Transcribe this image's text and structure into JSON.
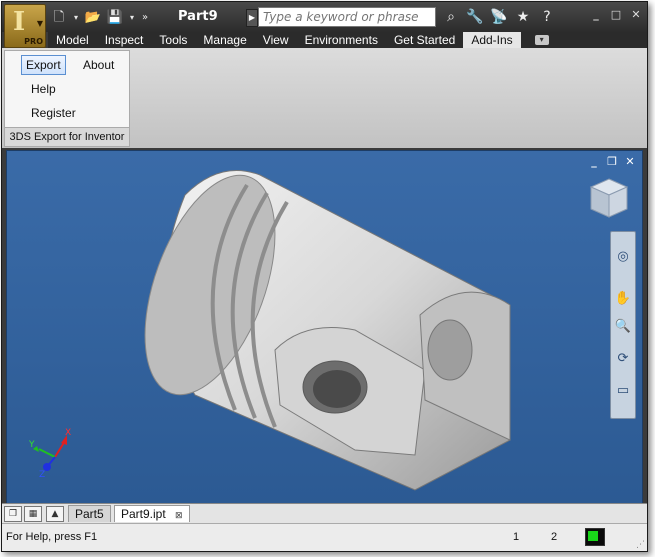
{
  "window": {
    "title": "Part9",
    "app_badge": "PRO",
    "search_placeholder": "Type a keyword or phrase"
  },
  "tabs": [
    {
      "label": "Model"
    },
    {
      "label": "Inspect"
    },
    {
      "label": "Tools"
    },
    {
      "label": "Manage"
    },
    {
      "label": "View"
    },
    {
      "label": "Environments"
    },
    {
      "label": "Get Started"
    },
    {
      "label": "Add-Ins",
      "active": true
    }
  ],
  "ribbon": {
    "export_label": "Export",
    "about_label": "About",
    "help_label": "Help",
    "register_label": "Register",
    "panel_title": "3DS Export for Inventor"
  },
  "documents": [
    {
      "label": "Part5"
    },
    {
      "label": "Part9.ipt",
      "active": true
    }
  ],
  "status": {
    "help_text": "For Help, press F1",
    "value1": "1",
    "value2": "2"
  },
  "triad": {
    "x_label": "X",
    "y_label": "Y",
    "z_label": "Z"
  },
  "colors": {
    "viewport": "#3a6ba8",
    "ribbon": "#dcdcdc",
    "title_bar": "#3b3b3b"
  }
}
